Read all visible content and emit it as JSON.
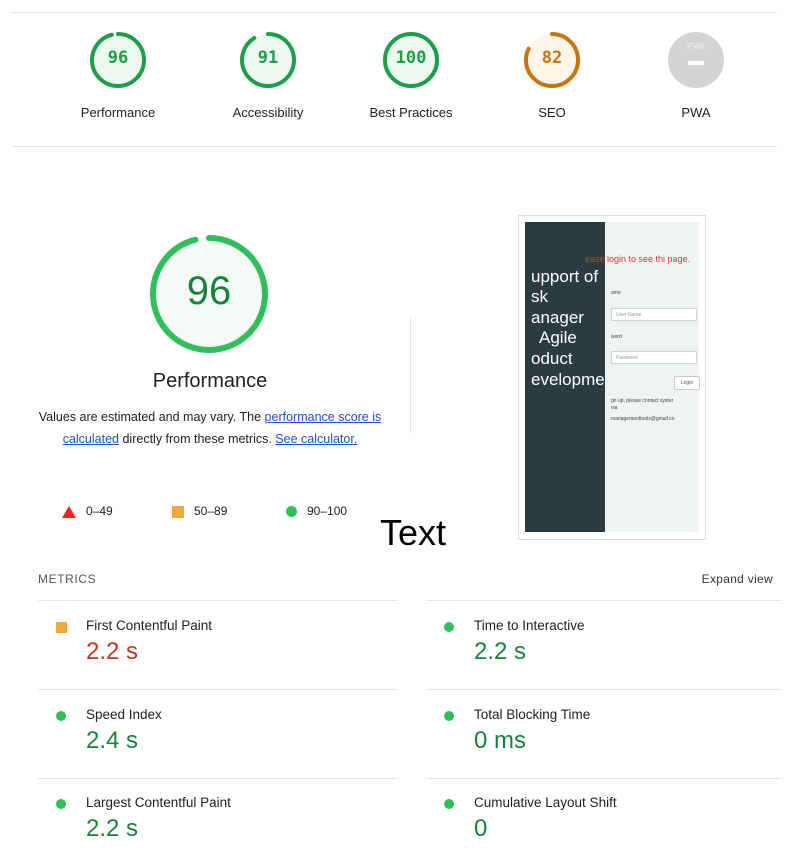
{
  "gauges": [
    {
      "score": "96",
      "label": "Performance",
      "color": "#1e9e4a",
      "fill": 0.96
    },
    {
      "score": "91",
      "label": "Accessibility",
      "color": "#1e9e4a",
      "fill": 0.91
    },
    {
      "score": "100",
      "label": "Best Practices",
      "color": "#1e9e4a",
      "fill": 1.0
    },
    {
      "score": "82",
      "label": "SEO",
      "color": "#c7740e",
      "fill": 0.82
    },
    {
      "score": "PWA",
      "label": "PWA",
      "color": "#d4d4d4"
    }
  ],
  "performance": {
    "score": "96",
    "fill": 0.96,
    "title": "Performance",
    "desc_1": "Values are estimated and may vary. The ",
    "link_1": "performance score is calculated",
    "desc_2": " directly from these metrics. ",
    "link_2": "See calculator.",
    "legend": [
      {
        "icon": "triangle",
        "label": "0–49",
        "color": "#e5261f"
      },
      {
        "icon": "square",
        "label": "50–89",
        "color": "#f4a73b"
      },
      {
        "icon": "circle",
        "label": "90–100",
        "color": "#2fbf5b"
      }
    ]
  },
  "overlay_text": "Text",
  "thumbnail": {
    "dark_lines": [
      "upport of",
      "sk",
      "anager",
      "Agile",
      "oduct",
      "evelopme"
    ],
    "login_message": "ease login to see thi page.",
    "username_label": "ame",
    "username_placeholder": "User Name",
    "password_label": "word",
    "password_placeholder": "Password",
    "login_button": "Login",
    "note_1": "gn up, please contact syster",
    "note_2": "via",
    "note_3": "managementtoolx@gmail.co"
  },
  "metrics": {
    "title": "METRICS",
    "expand_label": "Expand view",
    "items": [
      {
        "name": "First Contentful Paint",
        "value": "2.2 s",
        "status": "average",
        "color": "#c0351d"
      },
      {
        "name": "Time to Interactive",
        "value": "2.2 s",
        "status": "pass",
        "color": "#178239"
      },
      {
        "name": "Speed Index",
        "value": "2.4 s",
        "status": "pass",
        "color": "#178239"
      },
      {
        "name": "Total Blocking Time",
        "value": "0 ms",
        "status": "pass",
        "color": "#178239"
      },
      {
        "name": "Largest Contentful Paint",
        "value": "2.2 s",
        "status": "pass",
        "color": "#178239"
      },
      {
        "name": "Cumulative Layout Shift",
        "value": "0",
        "status": "pass",
        "color": "#178239"
      }
    ]
  }
}
